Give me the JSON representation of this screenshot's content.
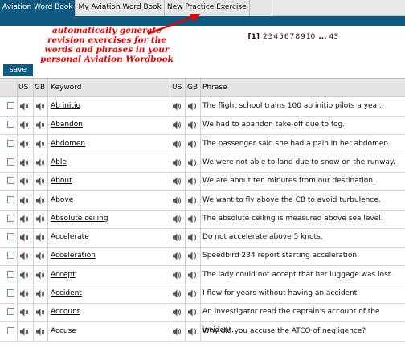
{
  "tabs": [
    "Aviation Word Book",
    "My Aviation Word Book",
    "New Practice Exercise",
    ""
  ],
  "annotation": "automatically generate revision exercises for the words and phrases in your personal Aviation Wordbook",
  "pager": {
    "current": "[1]",
    "pages": [
      "2",
      "3",
      "4",
      "5",
      "6",
      "7",
      "8",
      "9",
      "10"
    ],
    "ellipsis": "...",
    "last": "43"
  },
  "save_label": "save",
  "headers": {
    "us": "US",
    "gb": "GB",
    "keyword": "Keyword",
    "us2": "US",
    "gb2": "GB",
    "phrase": "Phrase"
  },
  "icons": {
    "checkbox": "checkbox",
    "speaker": "speaker-icon"
  },
  "colors": {
    "brand": "#0e5a80",
    "annotation": "#ee0000"
  },
  "rows": [
    {
      "keyword": "Ab initio",
      "phrase": "The flight school trains 100 ab initio pilots a year."
    },
    {
      "keyword": "Abandon",
      "phrase": "We had to abandon take-off due to fog."
    },
    {
      "keyword": "Abdomen",
      "phrase": "The passenger said she had a pain in her abdomen."
    },
    {
      "keyword": "Able",
      "phrase": "We were not able to land due to snow on the runway."
    },
    {
      "keyword": "About",
      "phrase": "We are about ten minutes from our destination."
    },
    {
      "keyword": "Above",
      "phrase": "We want to fly above the CB to avoid turbulence."
    },
    {
      "keyword": "Absolute ceiling",
      "phrase": "The absolute ceiling is measured above sea level."
    },
    {
      "keyword": "Accelerate",
      "phrase": "Do not accelerate above 5 knots."
    },
    {
      "keyword": "Acceleration",
      "phrase": "Speedbird 234 report starting acceleration."
    },
    {
      "keyword": "Accept",
      "phrase": "The lady could not accept that her luggage was lost."
    },
    {
      "keyword": "Accident",
      "phrase": "I flew for years without having an accident."
    },
    {
      "keyword": "Account",
      "phrase": "An investigator read the captain's account of the incident."
    },
    {
      "keyword": "Accuse",
      "phrase": "Why did you accuse the ATCO of negligence?"
    }
  ]
}
